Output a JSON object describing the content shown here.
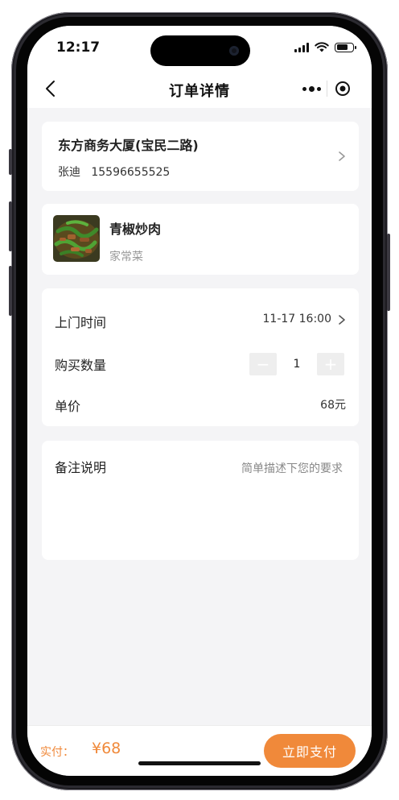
{
  "status_bar": {
    "time": "12:17"
  },
  "navbar": {
    "title": "订单详情"
  },
  "address": {
    "title": "东方商务大厦(宝民二路)",
    "name": "张迪",
    "phone": "15596655525"
  },
  "dish": {
    "name": "青椒炒肉",
    "category": "家常菜"
  },
  "order": {
    "visit_time_label": "上门时间",
    "visit_time_value": "11-17 16:00",
    "quantity_label": "购买数量",
    "quantity_value": "1",
    "minus": "−",
    "plus": "+",
    "price_label": "单价",
    "price_value": "68元"
  },
  "remark": {
    "label": "备注说明",
    "placeholder": "简单描述下您的要求"
  },
  "footer": {
    "pay_label": "实付：",
    "amount": "¥68",
    "pay_button": "立即支付"
  },
  "colors": {
    "accent": "#f0893a",
    "background": "#f4f4f6"
  },
  "icons": [
    "back-arrow-icon",
    "more-dots-icon",
    "close-target-icon",
    "chevron-right-icon",
    "signal-icon",
    "wifi-icon",
    "battery-icon"
  ]
}
